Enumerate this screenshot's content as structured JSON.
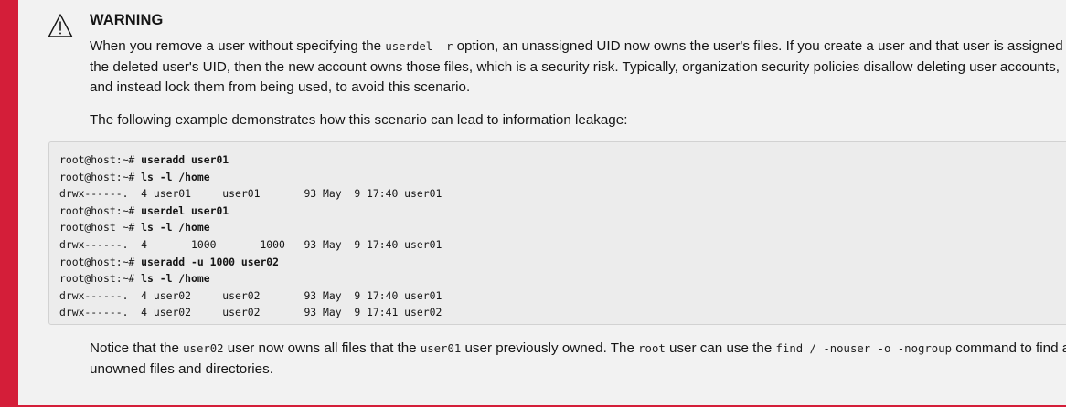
{
  "admonition": {
    "icon": "warning-triangle-icon",
    "accent_color": "#d41e39",
    "title": "WARNING",
    "p1": {
      "t1": "When you remove a user without specifying the ",
      "c1": "userdel -r",
      "t2": " option, an unassigned UID now owns the user's files. If you create a user and that user is assigned the deleted user's UID, then the new account owns those files, which is a security risk. Typically, organization security policies disallow deleting user accounts, and instead lock them from being used, to avoid this scenario."
    },
    "p2": "The following example demonstrates how this scenario can lead to information leakage:",
    "code_lines": [
      {
        "prompt": "root@host:~# ",
        "cmd": "useradd user01",
        "out": ""
      },
      {
        "prompt": "root@host:~# ",
        "cmd": "ls -l /home",
        "out": ""
      },
      {
        "prompt": "",
        "cmd": "",
        "out": "drwx------.  4 user01     user01       93 May  9 17:40 user01"
      },
      {
        "prompt": "root@host:~# ",
        "cmd": "userdel user01",
        "out": ""
      },
      {
        "prompt": "root@host ~# ",
        "cmd": "ls -l /home",
        "out": ""
      },
      {
        "prompt": "",
        "cmd": "",
        "out": "drwx------.  4       1000       1000   93 May  9 17:40 user01"
      },
      {
        "prompt": "root@host:~# ",
        "cmd": "useradd -u 1000 user02",
        "out": ""
      },
      {
        "prompt": "root@host:~# ",
        "cmd": "ls -l /home",
        "out": ""
      },
      {
        "prompt": "",
        "cmd": "",
        "out": "drwx------.  4 user02     user02       93 May  9 17:40 user01"
      },
      {
        "prompt": "",
        "cmd": "",
        "out": "drwx------.  4 user02     user02       93 May  9 17:41 user02"
      }
    ],
    "p3": {
      "t1": "Notice that the ",
      "c1": "user02",
      "t2": " user now owns all files that the ",
      "c2": "user01",
      "t3": " user previously owned. The ",
      "c3": "root",
      "t4": " user can use the ",
      "c4": "find / -nouser -o -nogroup",
      "t5": " command to find all unowned files and directories."
    }
  }
}
